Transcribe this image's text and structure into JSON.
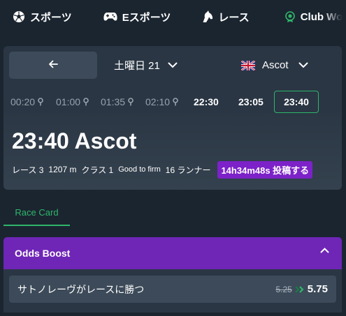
{
  "nav": {
    "items": [
      {
        "label": "スポーツ",
        "icon": "soccer-ball-icon"
      },
      {
        "label": "Eスポーツ",
        "icon": "gamepad-icon"
      },
      {
        "label": "レース",
        "icon": "horse-head-icon"
      },
      {
        "label": "Club Wo",
        "icon": "club-badge-icon"
      }
    ]
  },
  "selector": {
    "back_icon": "arrow-left-icon",
    "date_label": "土曜日 21",
    "venue_label": "Ascot",
    "venue_flag": "uk-flag-icon"
  },
  "times": [
    {
      "label": "00:20",
      "state": "past"
    },
    {
      "label": "01:00",
      "state": "past"
    },
    {
      "label": "01:35",
      "state": "past"
    },
    {
      "label": "02:10",
      "state": "past"
    },
    {
      "label": "22:30",
      "state": "future"
    },
    {
      "label": "23:05",
      "state": "future"
    },
    {
      "label": "23:40",
      "state": "active"
    }
  ],
  "race": {
    "title": "23:40 Ascot",
    "race_no": "レース 3",
    "distance": "1207 m",
    "class": "クラス 1",
    "going": "Good to firm",
    "runners": "16 ランナー",
    "countdown": "14h34m48s 投稿する"
  },
  "tabs": [
    {
      "label": "Race Card",
      "active": true
    }
  ],
  "odds_boost": {
    "title": "Odds Boost",
    "selection": "サトノレーヴがレースに勝つ",
    "old_odds": "5.25",
    "new_odds": "5.75"
  },
  "colors": {
    "background": "#1b2530",
    "panel": "#2a3644",
    "accent_green": "#2fb66a",
    "boost_purple": "#6f26b6",
    "countdown_purple": "#7c22c8"
  }
}
